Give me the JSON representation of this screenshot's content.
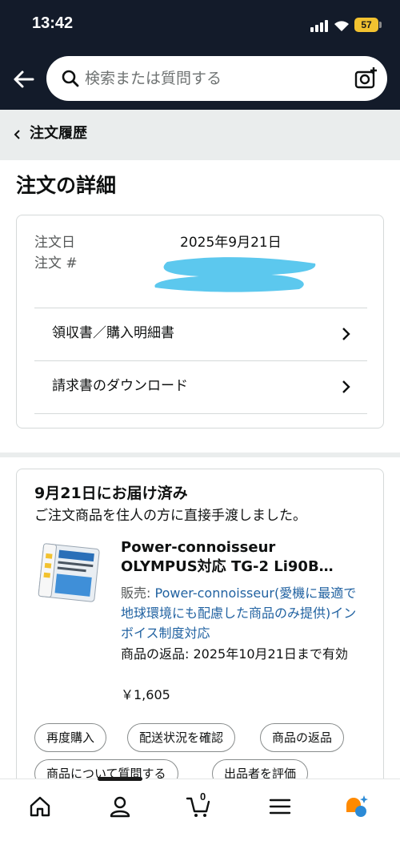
{
  "status_bar": {
    "time": "13:42",
    "battery": "57"
  },
  "header": {
    "search_placeholder": "検索または質問する"
  },
  "breadcrumb": {
    "label": "注文履歴"
  },
  "page": {
    "title": "注文の詳細"
  },
  "order_summary": {
    "order_date_label": "注文日",
    "order_date_value": "2025年9月21日",
    "order_number_label": "注文 #",
    "links": [
      {
        "label": "領収書／購入明細書"
      },
      {
        "label": "請求書のダウンロード"
      }
    ]
  },
  "shipment": {
    "status": "9月21日にお届け済み",
    "detail": "ご注文商品を住人の方に直接手渡しました。",
    "product": {
      "title_line1": "Power-connoisseur",
      "title_line2": "OLYMPUS対応 TG-2 Li90B…",
      "seller_label": "販売: ",
      "seller_name": "Power-connoisseur(愛機に最適で地球環境にも配慮した商品のみ提供)インボイス制度対応",
      "return_text": "商品の返品: 2025年10月21日まで有効",
      "price": "￥1,605",
      "thumb_text": "FOR OLYMPUS Li-90B/92B 3.7V 1800mAh"
    },
    "actions": [
      "再度購入",
      "配送状況を確認",
      "商品の返品",
      "商品について質問する",
      "出品者を評価"
    ]
  },
  "tab_bar": {
    "cart_count": "0"
  },
  "colors": {
    "header_bg": "#131b2a",
    "link": "#2162a1",
    "accent": "#ff8a00",
    "rufus": "#2b8ad6"
  }
}
